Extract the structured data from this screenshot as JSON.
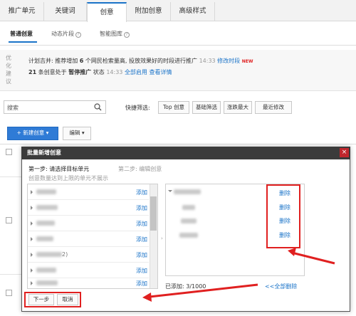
{
  "tabs": [
    "推广单元",
    "关键词",
    "创意",
    "附加创意",
    "高级样式"
  ],
  "subtabs": [
    "普通创意",
    "动态片段",
    "智能图库"
  ],
  "suggestion": {
    "label": "优化建议",
    "line1": {
      "text": "计划吉并: 推荐增加",
      "num": "6",
      "text2": "个网民检索量高, 投放效果好的时段进行推广",
      "time": "14:33",
      "link": "修改时段",
      "badge": "NEW"
    },
    "line2": {
      "num": "21",
      "text": "条创意处于",
      "status": "暂停推广",
      "text2": "状态",
      "time": "14:33",
      "link1": "全部启用",
      "link2": "查看详情"
    }
  },
  "search": {
    "placeholder": "搜索"
  },
  "quick_filter": {
    "label": "快捷筛选:",
    "buttons": [
      "Top 创意",
      "基础筛选",
      "涨跌最大",
      "最近修改"
    ]
  },
  "toolbar": {
    "new_label": "+ 新建创意",
    "edit_label": "编辑"
  },
  "modal": {
    "title": "批量新增创意",
    "close": "×",
    "step1": "第一步: 请选择目标单元",
    "step2": "第二步: 编辑创意",
    "note": "创意数量达到上限的单元不展示",
    "add_label": "添加",
    "left_suffix": "2)",
    "delete_label": "删除",
    "added": "已添加: 3/1000",
    "clear_link": "<<全部删除",
    "next": "下一步",
    "cancel": "取消"
  },
  "colors": {
    "accent": "#1a73c8",
    "highlight": "#e02020",
    "title_bar": "#3b3b3b"
  }
}
